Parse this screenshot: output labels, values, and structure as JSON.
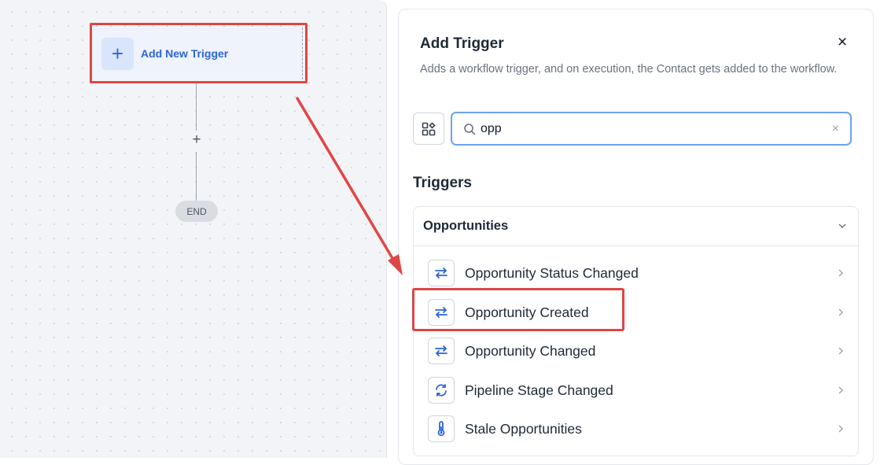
{
  "canvas": {
    "trigger_node": {
      "label": "Add New Trigger",
      "plus": "+"
    },
    "add_step": "+",
    "end_label": "END"
  },
  "panel": {
    "title": "Add Trigger",
    "close": "×",
    "description": "Adds a workflow trigger, and on execution, the Contact gets added to the workflow.",
    "search": {
      "value": "opp",
      "clear": "×"
    },
    "section_title": "Triggers",
    "group": {
      "title": "Opportunities",
      "items": [
        {
          "label": "Opportunity Status Changed",
          "icon": "swap-arrows-icon"
        },
        {
          "label": "Opportunity Created",
          "icon": "swap-arrows-icon"
        },
        {
          "label": "Opportunity Changed",
          "icon": "swap-arrows-icon"
        },
        {
          "label": "Pipeline Stage Changed",
          "icon": "refresh-icon"
        },
        {
          "label": "Stale Opportunities",
          "icon": "thermometer-icon"
        }
      ]
    }
  },
  "colors": {
    "accent": "#2c64d8",
    "highlight": "#e04646",
    "search_border": "#6ea2ee"
  }
}
